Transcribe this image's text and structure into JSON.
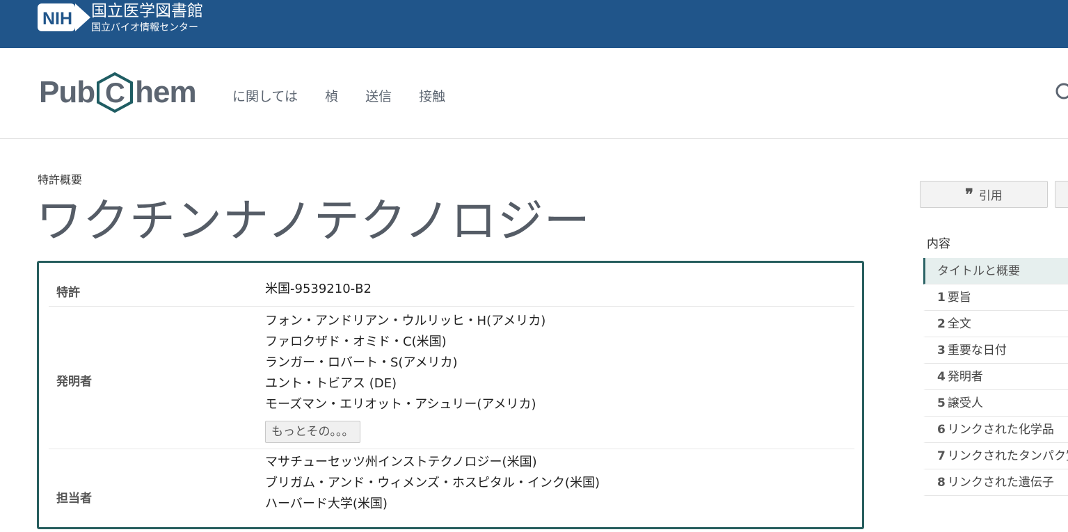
{
  "nih": {
    "logo_text": "NIH",
    "title": "国立医学図書館",
    "subtitle": "国立バイオ情報センター"
  },
  "header": {
    "nav": [
      "に関しては",
      "楨",
      "送信",
      "接触"
    ]
  },
  "page": {
    "breadcrumb": "特許概要",
    "title": "ワクチンナノテクノロジー"
  },
  "summary": {
    "patent_label": "特許",
    "patent_value": "米国-9539210-B2",
    "inventor_label": "発明者",
    "inventors": [
      "フォン・アンドリアン・ウルリッヒ・H(アメリカ)",
      "ファロクザド・オミド・C(米国)",
      "ランガー・ロバート・S(アメリカ)",
      "ユント・トビアス (DE)",
      "モーズマン・エリオット・アシュリー(アメリカ)"
    ],
    "more_label": "もっとその。。。",
    "assignee_label": "担当者",
    "assignees": [
      "マサチューセッツ州インストテクノロジー(米国)",
      "ブリガム・アンド・ウィメンズ・ホスピタル・インク(米国)",
      "ハーバード大学(米国)"
    ]
  },
  "sidebar": {
    "cite_label": "引用",
    "toc_title": "内容",
    "toc": [
      {
        "num": "",
        "label": "タイトルと概要"
      },
      {
        "num": "1",
        "label": "要旨"
      },
      {
        "num": "2",
        "label": "全文"
      },
      {
        "num": "3",
        "label": "重要な日付"
      },
      {
        "num": "4",
        "label": "発明者"
      },
      {
        "num": "5",
        "label": "譲受人"
      },
      {
        "num": "6",
        "label": "リンクされた化学品"
      },
      {
        "num": "7",
        "label": "リンクされたタンパク質"
      },
      {
        "num": "8",
        "label": "リンクされた遺伝子"
      }
    ]
  },
  "colors": {
    "nih_blue": "#20558a",
    "box_border": "#275e5e",
    "toc_active": "#e6efee"
  }
}
